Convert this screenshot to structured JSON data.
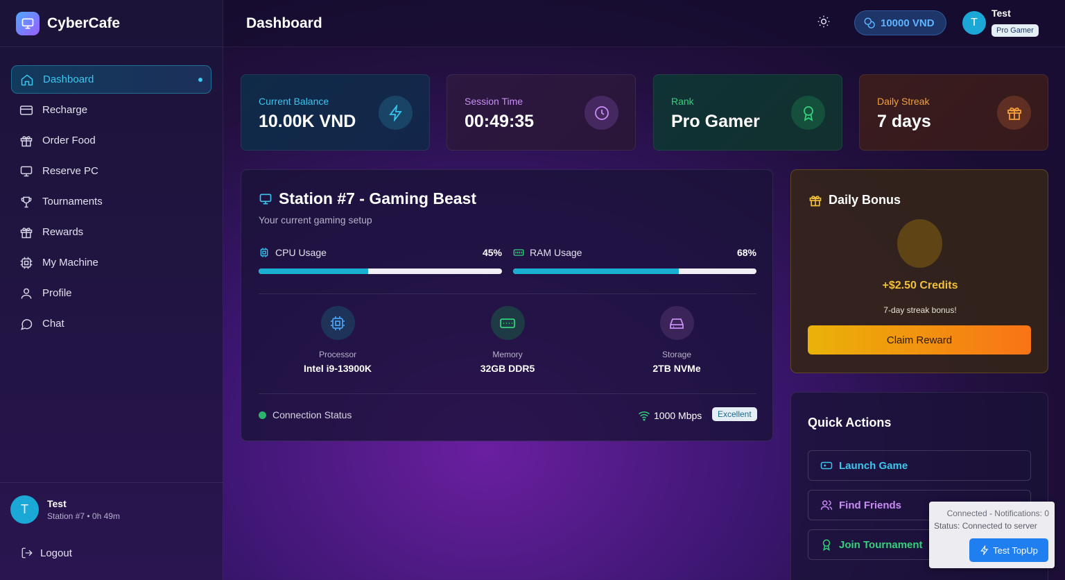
{
  "app": {
    "name": "CyberCafe"
  },
  "sidebar": {
    "items": [
      {
        "label": "Dashboard",
        "icon": "home-icon",
        "active": true
      },
      {
        "label": "Recharge",
        "icon": "credit-card-icon"
      },
      {
        "label": "Order Food",
        "icon": "gift-icon"
      },
      {
        "label": "Reserve PC",
        "icon": "monitor-icon"
      },
      {
        "label": "Tournaments",
        "icon": "trophy-icon"
      },
      {
        "label": "Rewards",
        "icon": "gift-icon"
      },
      {
        "label": "My Machine",
        "icon": "cpu-icon"
      },
      {
        "label": "Profile",
        "icon": "user-icon"
      },
      {
        "label": "Chat",
        "icon": "chat-icon"
      }
    ],
    "footer": {
      "avatar_initial": "T",
      "user_name": "Test",
      "user_sub": "Station #7 • 0h 49m",
      "logout_label": "Logout"
    }
  },
  "header": {
    "title": "Dashboard",
    "balance": "10000 VND",
    "avatar_initial": "T",
    "user_name": "Test",
    "user_badge": "Pro Gamer"
  },
  "stats": [
    {
      "label": "Current Balance",
      "value": "10.00K VND",
      "icon": "lightning-icon",
      "accent": "#39c6f0"
    },
    {
      "label": "Session Time",
      "value": "00:49:35",
      "icon": "clock-icon",
      "accent": "#c98cf5"
    },
    {
      "label": "Rank",
      "value": "Pro Gamer",
      "icon": "award-icon",
      "accent": "#34d27a"
    },
    {
      "label": "Daily Streak",
      "value": "7 days",
      "icon": "gift-icon",
      "accent": "#f6a03a"
    }
  ],
  "station": {
    "title": "Station #7 - Gaming Beast",
    "subtitle": "Your current gaming setup",
    "cpu": {
      "label": "CPU Usage",
      "value": "45%",
      "fraction": 0.45
    },
    "ram": {
      "label": "RAM Usage",
      "value": "68%",
      "fraction": 0.68
    },
    "specs": [
      {
        "label": "Processor",
        "value": "Intel i9-13900K",
        "icon": "cpu-icon"
      },
      {
        "label": "Memory",
        "value": "32GB DDR5",
        "icon": "memory-icon"
      },
      {
        "label": "Storage",
        "value": "2TB NVMe",
        "icon": "storage-icon"
      }
    ],
    "connection_label": "Connection Status",
    "speed": "1000 Mbps",
    "quality": "Excellent"
  },
  "bonus": {
    "title": "Daily Bonus",
    "credits": "+$2.50 Credits",
    "note": "7-day streak bonus!",
    "claim_label": "Claim Reward"
  },
  "quick_actions": {
    "title": "Quick Actions",
    "items": [
      {
        "label": "Launch Game",
        "icon": "gamepad-icon",
        "color": "#3cc8ef"
      },
      {
        "label": "Find Friends",
        "icon": "users-icon",
        "color": "#c98cf5"
      },
      {
        "label": "Join Tournament",
        "icon": "award-icon",
        "color": "#34d27a"
      }
    ]
  },
  "toast": {
    "line1": "Connected - Notifications: 0",
    "line2": "Status: Connected to server",
    "button_label": "Test TopUp"
  }
}
